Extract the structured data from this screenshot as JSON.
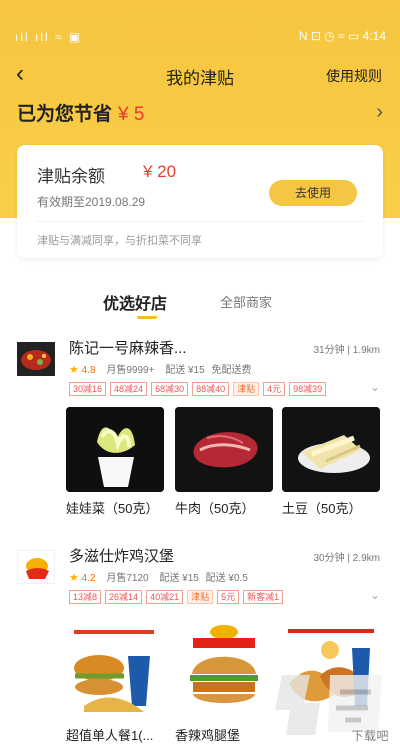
{
  "status_bar": {
    "left": "ıll ıll ≈ ▣",
    "right": "N ⊡ ◷ ≈ ▭ 4:14"
  },
  "header": {
    "title": "我的津贴",
    "rules": "使用规则"
  },
  "savings": {
    "label": "已为您节省",
    "amount": "¥ 5"
  },
  "allowance_card": {
    "label": "津贴余额",
    "amount": "¥ 20",
    "expiry": "有效期至2019.08.29",
    "button": "去使用",
    "note": "津贴与满减同享，与折扣菜不同享"
  },
  "tabs": [
    {
      "label": "优选好店"
    },
    {
      "label": "全部商家"
    }
  ],
  "stores": [
    {
      "name": "陈记一号麻辣香...",
      "time_distance": "31分钟 | 1.9km",
      "rating": "4.8",
      "sales": "月售9999+",
      "delivery": "配送 ¥15",
      "delivery_fee": "免配送费",
      "promos": [
        "30减16",
        "48减24",
        "68减30",
        "88减40",
        "津贴",
        "4元",
        "98减39"
      ],
      "foods": [
        {
          "name": "娃娃菜（50克）"
        },
        {
          "name": "牛肉（50克）"
        },
        {
          "name": "土豆（50克）"
        }
      ]
    },
    {
      "name": "多滋仕炸鸡汉堡",
      "time_distance": "30分钟 | 2.9km",
      "rating": "4.2",
      "sales": "月售7120",
      "delivery": "配送 ¥15",
      "delivery_fee": "配送 ¥0.5",
      "promos": [
        "13减8",
        "26减14",
        "40减21",
        "津贴",
        "5元",
        "新客减1"
      ],
      "foods": [
        {
          "name": "超值单人餐1(..."
        },
        {
          "name": "香辣鸡腿堡"
        },
        {
          "name": ""
        }
      ]
    }
  ],
  "watermark": "下载吧",
  "colors": {
    "yellow": "#f7c540",
    "red": "#e83b2f",
    "orange": "#ee6d2b",
    "star": "#ffb400"
  },
  "icons": [
    "back-arrow-icon",
    "chevron-right-icon",
    "star-icon",
    "dropdown-icon"
  ]
}
